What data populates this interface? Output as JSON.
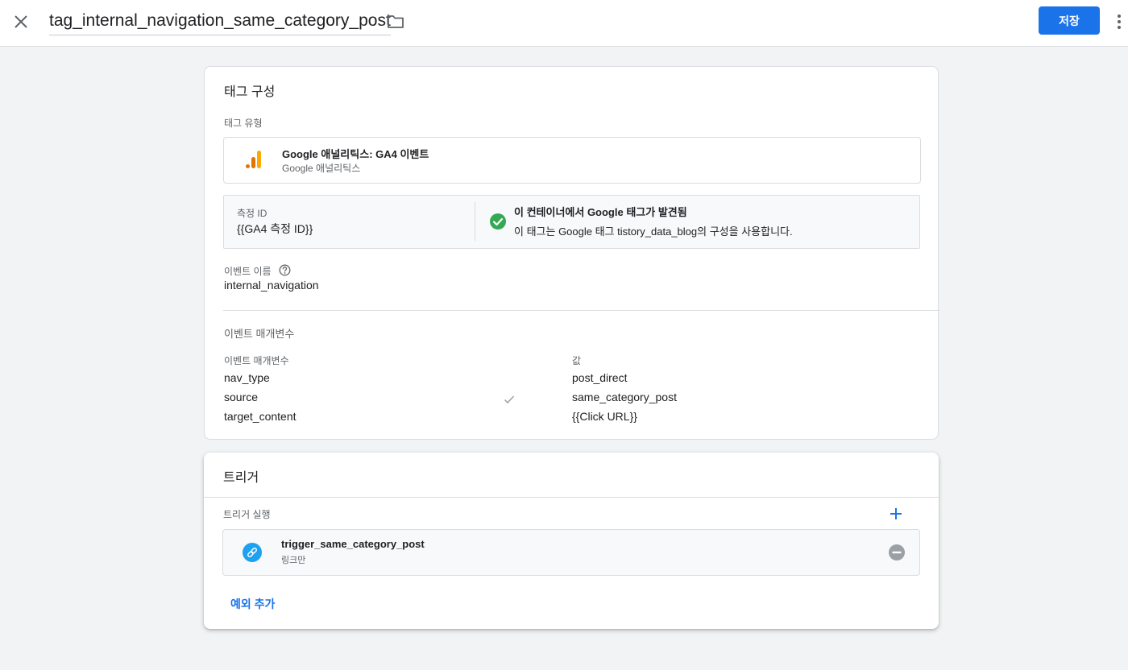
{
  "header": {
    "tag_name": "tag_internal_navigation_same_category_post",
    "save_label": "저장"
  },
  "tag_config": {
    "title": "태그 구성",
    "tag_type_label": "태그 유형",
    "tag_type_name": "Google 애널리틱스: GA4 이벤트",
    "tag_type_vendor": "Google 애널리틱스",
    "measurement_id_label": "측정 ID",
    "measurement_id_value": "{{GA4 측정 ID}}",
    "found_title": "이 컨테이너에서 Google 태그가 발견됨",
    "found_desc": "이 태그는 Google 태그 tistory_data_blog의 구성을 사용합니다.",
    "event_name_label": "이벤트 이름",
    "event_name_value": "internal_navigation",
    "params_section_title": "이벤트 매개변수",
    "params_col_name": "이벤트 매개변수",
    "params_col_value": "값",
    "params": [
      {
        "name": "nav_type",
        "value": "post_direct"
      },
      {
        "name": "source",
        "value": "same_category_post"
      },
      {
        "name": "target_content",
        "value": "{{Click URL}}"
      }
    ]
  },
  "trigger": {
    "title": "트리거",
    "firing_label": "트리거 실행",
    "trigger_name": "trigger_same_category_post",
    "trigger_type": "링크만",
    "add_exception": "예외 추가"
  },
  "colors": {
    "accent": "#1a73e8",
    "success": "#34a853",
    "ga_orange": "#f9ab00",
    "ga_dark_orange": "#e37400",
    "link_icon": "#1ea1f1"
  }
}
